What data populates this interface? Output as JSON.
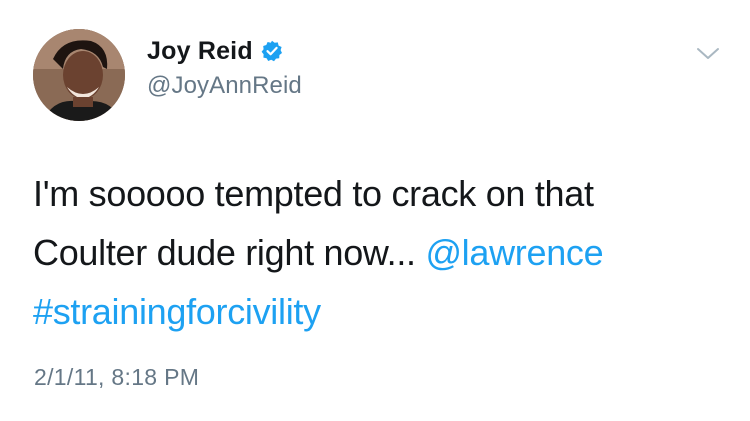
{
  "author": {
    "display_name": "Joy Reid",
    "handle": "@JoyAnnReid",
    "verified": true
  },
  "tweet": {
    "text_part1": "I'm sooooo tempted to crack on that Coulter dude right now... ",
    "mention": "@lawrence",
    "hashtag": "#strainingforcivility",
    "timestamp": "2/1/11, 8:18 PM"
  },
  "icons": {
    "verified": "verified-badge-icon",
    "menu": "chevron-down-icon"
  },
  "colors": {
    "link": "#1da1f2",
    "secondary_text": "#657786",
    "primary_text": "#14171a"
  }
}
